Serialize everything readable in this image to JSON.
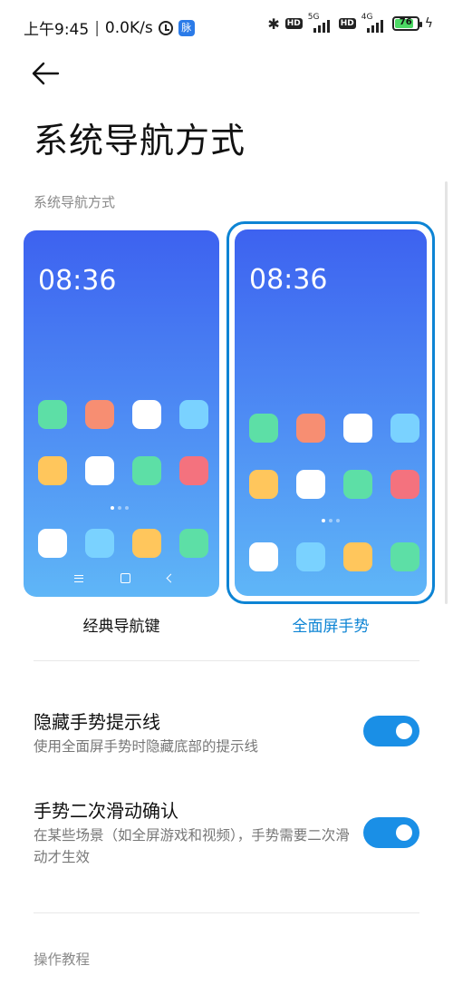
{
  "status_bar": {
    "time": "上午9:45",
    "speed": "0.0K/s",
    "app_badge": "脉",
    "hd1": "HD",
    "network1": "5G",
    "hd2": "HD",
    "network2": "4G",
    "battery": "76"
  },
  "page": {
    "title": "系统导航方式",
    "section_title": "系统导航方式"
  },
  "previews": {
    "clock_text": "08:36",
    "classic_label": "经典导航键",
    "gesture_label": "全面屏手势",
    "selected": "gesture",
    "app_tile_colors": [
      "#5ddfa6",
      "#f78e72",
      "#ffffff",
      "#7ad2ff",
      "#ffc65c",
      "#ffffff",
      "#5ddfa6",
      "#f4727e"
    ],
    "dock_tile_colors": [
      "#ffffff",
      "#7ad2ff",
      "#ffc65c",
      "#5ddfa6"
    ]
  },
  "settings": {
    "hide_hint_line": {
      "title": "隐藏手势提示线",
      "description": "使用全面屏手势时隐藏底部的提示线",
      "enabled": true
    },
    "double_swipe_confirm": {
      "title": "手势二次滑动确认",
      "description": "在某些场景（如全屏游戏和视频），手势需要二次滑动才生效",
      "enabled": true
    }
  },
  "footer": {
    "tutorial_link": "操作教程"
  },
  "colors": {
    "accent": "#0d84d4",
    "toggle_on": "#1a8fe6"
  }
}
